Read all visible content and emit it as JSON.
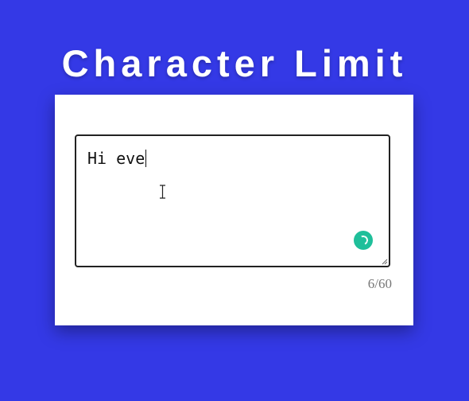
{
  "page": {
    "title": "Character Limit"
  },
  "editor": {
    "value": "Hi eve",
    "counter": "6/60",
    "max_length": 60,
    "current_length": 6
  },
  "icons": {
    "cursor": "i-beam-cursor-icon",
    "status": "loading-spinner-icon",
    "resize": "resize-handle-icon"
  },
  "colors": {
    "background": "#3439e6",
    "card": "#ffffff",
    "spinner": "#1fbf9a",
    "counter_text": "#777777"
  }
}
